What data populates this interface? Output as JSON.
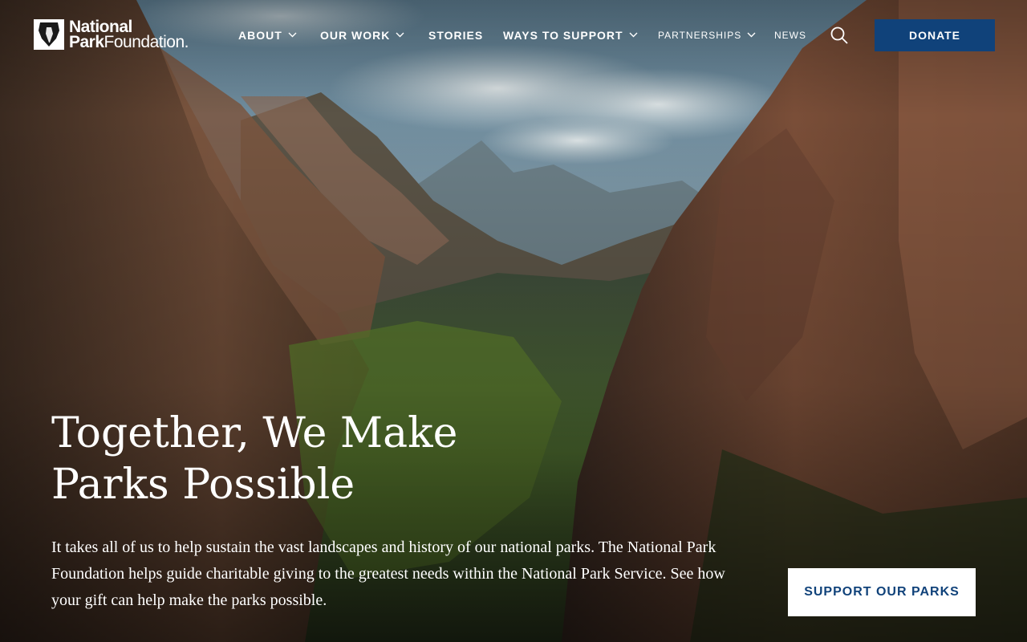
{
  "brand": {
    "line1": "National",
    "line2_bold": "Park",
    "line2_regular": "Foundation."
  },
  "nav": {
    "items": [
      {
        "label": "ABOUT",
        "has_dropdown": true
      },
      {
        "label": "OUR WORK",
        "has_dropdown": true
      },
      {
        "label": "STORIES",
        "has_dropdown": false
      },
      {
        "label": "WAYS TO SUPPORT",
        "has_dropdown": true
      },
      {
        "label": "PARTNERSHIPS",
        "has_dropdown": true
      },
      {
        "label": "NEWS",
        "has_dropdown": false
      }
    ],
    "search_icon": "search-icon",
    "donate_label": "DONATE"
  },
  "hero": {
    "title_line1": "Together, We Make",
    "title_line2": "Parks Possible",
    "body": "It takes all of us to help sustain the vast landscapes and history of our national parks. The National Park Foundation helps guide charitable giving to the greatest needs within the National Park Service. See how your gift can help make the parks possible.",
    "cta_label": "SUPPORT OUR PARKS",
    "background": "canyon-landscape-photo"
  },
  "colors": {
    "brand_blue": "#10427a",
    "text_on_image": "#ffffff"
  }
}
